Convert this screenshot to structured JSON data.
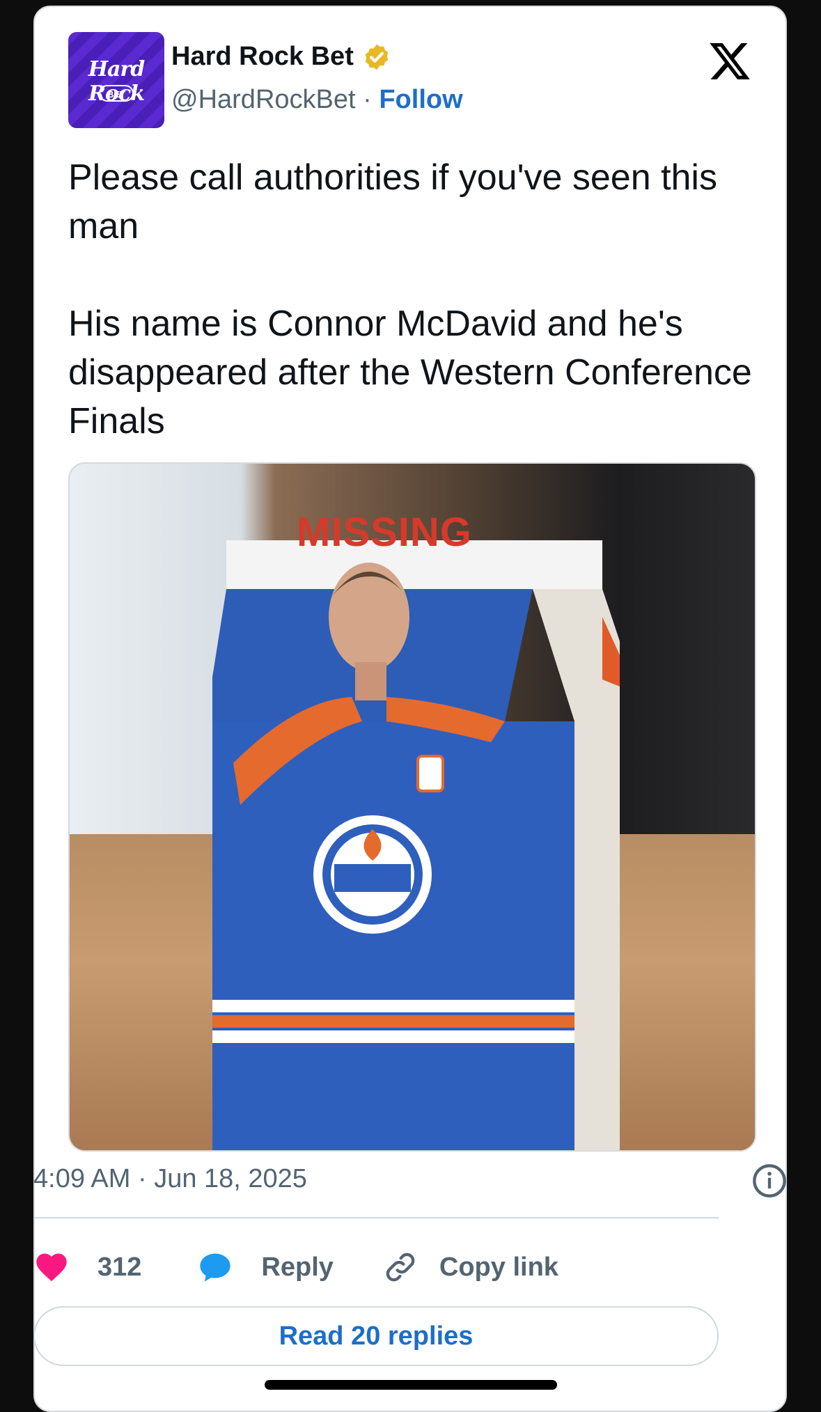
{
  "account": {
    "name": "Hard Rock Bet",
    "handle": "@HardRockBet",
    "separator": "·",
    "follow_label": "Follow",
    "avatar_logo": "Hard Rock",
    "avatar_sub": "BET"
  },
  "tweet": {
    "line1": "Please call authorities if you've seen this man",
    "line2": "His name is Connor McDavid and he's disappeared after the Western Conference Finals"
  },
  "media": {
    "carton_text": "MISSING"
  },
  "meta": {
    "timestamp": "4:09 AM · Jun 18, 2025"
  },
  "actions": {
    "like_count": "312",
    "reply_label": "Reply",
    "copy_label": "Copy link"
  },
  "read_replies_label": "Read 20 replies",
  "icons": [
    "verified-badge-icon",
    "x-logo-icon",
    "info-icon",
    "heart-icon",
    "reply-bubble-icon",
    "link-icon"
  ],
  "colors": {
    "accent": "#1d6ec9",
    "like": "#f91880",
    "reply": "#1d9bf0",
    "verified": "#e8b923",
    "avatar": "#5a2ad0"
  }
}
